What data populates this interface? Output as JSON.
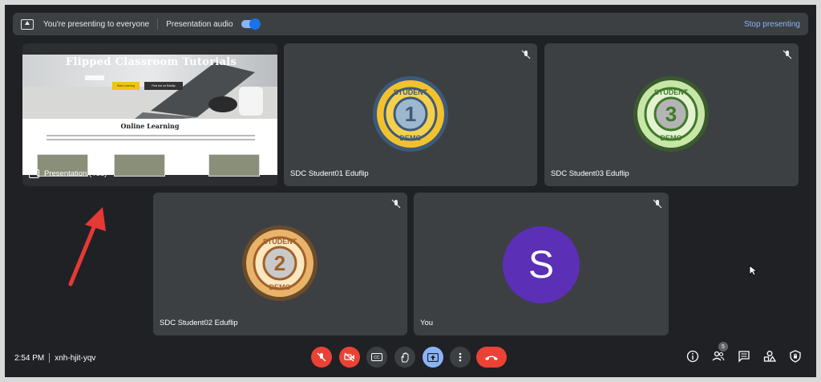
{
  "banner": {
    "presenting_text": "You're presenting to everyone",
    "audio_label": "Presentation audio",
    "stop_label": "Stop presenting"
  },
  "presentation": {
    "slide_title": "Flipped Classroom Tutorials",
    "slide_button_1": "Start Learning",
    "slide_button_2": "Find me on Eduflip",
    "slide_subheading": "Online Learning",
    "label": "Presentation (You)"
  },
  "participants": [
    {
      "name": "SDC Student01 Eduflip",
      "badge_number": "1",
      "badge_top": "STUDENT",
      "badge_bottom": "DEMO"
    },
    {
      "name": "SDC Student03 Eduflip",
      "badge_number": "3",
      "badge_top": "STUDENT",
      "badge_bottom": "DEMO"
    },
    {
      "name": "SDC Student02 Eduflip",
      "badge_number": "2",
      "badge_top": "STUDENT",
      "badge_bottom": "DEMO"
    },
    {
      "name": "You",
      "initial": "S"
    }
  ],
  "bottom_bar": {
    "time": "2:54 PM",
    "meeting_code": "xnh-hjit-yqv",
    "participant_count": "5"
  },
  "colors": {
    "accent": "#8ab4f8",
    "danger": "#ea4335",
    "avatar": "#5b2fb6",
    "arrow": "#e53935"
  }
}
